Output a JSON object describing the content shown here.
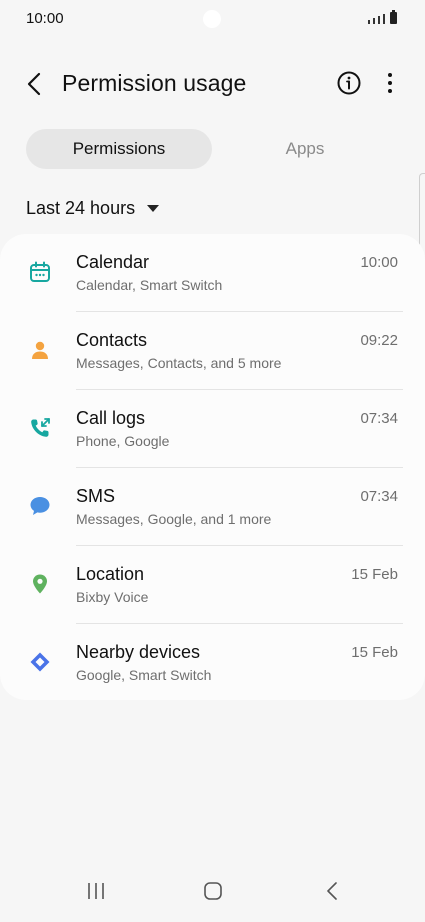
{
  "status_bar": {
    "time": "10:00"
  },
  "header": {
    "title": "Permission usage"
  },
  "tabs": [
    {
      "label": "Permissions",
      "selected": true
    },
    {
      "label": "Apps",
      "selected": false
    }
  ],
  "filter": {
    "label": "Last 24 hours"
  },
  "permissions": [
    {
      "title": "Calendar",
      "subtitle": "Calendar, Smart Switch",
      "time": "10:00",
      "icon": "calendar-icon",
      "color": "#17a7a0"
    },
    {
      "title": "Contacts",
      "subtitle": "Messages, Contacts, and 5 more",
      "time": "09:22",
      "icon": "person-icon",
      "color": "#f4a340"
    },
    {
      "title": "Call logs",
      "subtitle": "Phone, Google",
      "time": "07:34",
      "icon": "call-log-icon",
      "color": "#17a7a0"
    },
    {
      "title": "SMS",
      "subtitle": "Messages, Google, and 1 more",
      "time": "07:34",
      "icon": "chat-bubble-icon",
      "color": "#4a90e2"
    },
    {
      "title": "Location",
      "subtitle": "Bixby Voice",
      "time": "15 Feb",
      "icon": "location-pin-icon",
      "color": "#5fb25f"
    },
    {
      "title": "Nearby devices",
      "subtitle": "Google, Smart Switch",
      "time": "15 Feb",
      "icon": "nearby-devices-icon",
      "color": "#4a73e8"
    }
  ],
  "colors": {
    "background": "#f6f6f6",
    "card": "#fcfcfc",
    "tab_selected": "#e6e6e6"
  }
}
